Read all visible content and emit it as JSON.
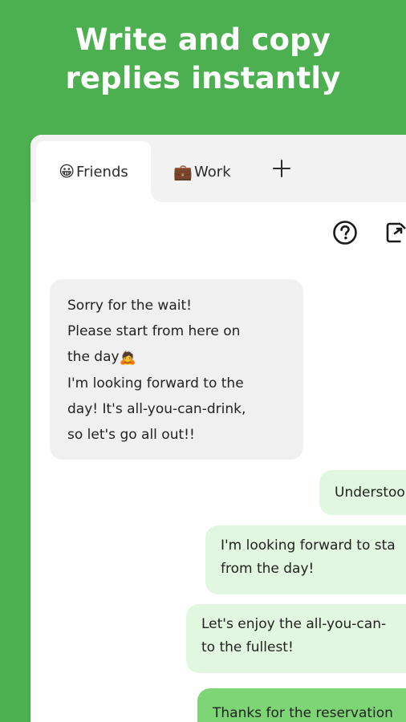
{
  "headline": {
    "line1": "Write and copy",
    "line2": "replies instantly"
  },
  "tabs": [
    {
      "emoji": "😀",
      "label": "Friends",
      "active": true
    },
    {
      "emoji": "💼",
      "label": "Work",
      "active": false
    }
  ],
  "toolbar": {
    "help_icon": "question-circle-icon",
    "export_icon": "export-icon"
  },
  "messages": {
    "incoming": {
      "lines": [
        "Sorry for the wait!",
        "Please start from here on",
        "the day",
        "I'm looking forward to the",
        "day! It's all-you-can-drink,",
        "so let's go all out!!"
      ],
      "emoji": "🙇"
    },
    "outgoing": [
      {
        "lines": [
          "Understoo"
        ]
      },
      {
        "lines": [
          "I'm looking forward to sta",
          "from the day!"
        ]
      },
      {
        "lines": [
          "Let's enjoy the all-you-can-",
          "to the fullest!"
        ]
      },
      {
        "lines": [
          "Thanks for the reservation"
        ]
      }
    ]
  },
  "colors": {
    "background": "#4caf50",
    "incoming_bubble": "#f0f0f0",
    "outgoing_bubble": "#e1f7df",
    "highlight_bubble": "#7dd576"
  }
}
